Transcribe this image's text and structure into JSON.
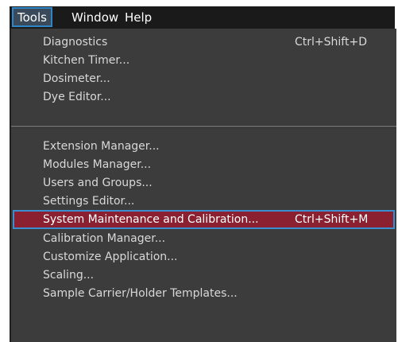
{
  "menubar": {
    "items": [
      {
        "label": "Tools"
      },
      {
        "label": "Window"
      },
      {
        "label": "Help"
      }
    ]
  },
  "tools_menu": {
    "group1": [
      {
        "label": "Diagnostics",
        "shortcut": "Ctrl+Shift+D"
      },
      {
        "label": "Kitchen Timer..."
      },
      {
        "label": "Dosimeter..."
      },
      {
        "label": "Dye Editor..."
      }
    ],
    "group2": [
      {
        "label": "Extension Manager..."
      },
      {
        "label": "Modules Manager..."
      },
      {
        "label": "Users and Groups..."
      },
      {
        "label": "Settings Editor..."
      },
      {
        "label": "System Maintenance and Calibration...",
        "shortcut": "Ctrl+Shift+M",
        "highlighted": true
      },
      {
        "label": "Calibration Manager..."
      },
      {
        "label": "Customize Application..."
      },
      {
        "label": "Scaling..."
      },
      {
        "label": "Sample Carrier/Holder Templates..."
      }
    ]
  },
  "colors": {
    "menubar_bg": "#1a1a1a",
    "dropdown_bg": "#3c3c3c",
    "highlight_bg": "#8a2030",
    "focus_border": "#3b8ed0",
    "text": "#d8d8d8"
  }
}
